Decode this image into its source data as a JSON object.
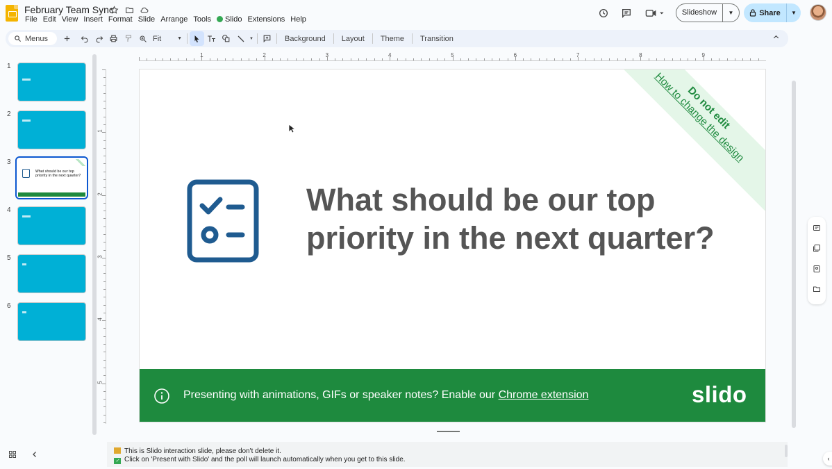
{
  "app": {
    "doc_title": "February Team Sync",
    "menu": [
      "File",
      "Edit",
      "View",
      "Insert",
      "Format",
      "Slide",
      "Arrange",
      "Tools",
      "Slido",
      "Extensions",
      "Help"
    ]
  },
  "header": {
    "slideshow_label": "Slideshow",
    "share_label": "Share"
  },
  "toolbar": {
    "search_label": "Menus",
    "zoom_label": "Fit",
    "background_label": "Background",
    "layout_label": "Layout",
    "theme_label": "Theme",
    "transition_label": "Transition"
  },
  "filmstrip": {
    "numbers": [
      "1",
      "2",
      "3",
      "4",
      "5",
      "6"
    ],
    "selected_thumb_text": "What should be our top priority in the next quarter?"
  },
  "ruler": {
    "h_labels": [
      "1",
      "2",
      "3",
      "4",
      "5",
      "6",
      "7",
      "8",
      "9"
    ],
    "v_labels": [
      "1",
      "2",
      "3",
      "4",
      "5"
    ]
  },
  "slide": {
    "question_line1": "What should be our top",
    "question_line2": "priority in the next quarter?",
    "ribbon_line1": "Do not edit",
    "ribbon_line2": "How to change the design",
    "banner_text": "Presenting with animations, GIFs or speaker notes? Enable our ",
    "banner_link": "Chrome extension",
    "brand_logo": "slido"
  },
  "notes": {
    "line1": "This is Slido interaction slide, please don't delete it.",
    "line2": "Click on 'Present with Slido' and the poll will launch automatically when you get to this slide."
  },
  "colors": {
    "slido_green": "#1e8a3e",
    "thumb_cyan": "#00b0d6",
    "icon_blue": "#1f5b90",
    "selection_blue": "#0b57d0"
  }
}
